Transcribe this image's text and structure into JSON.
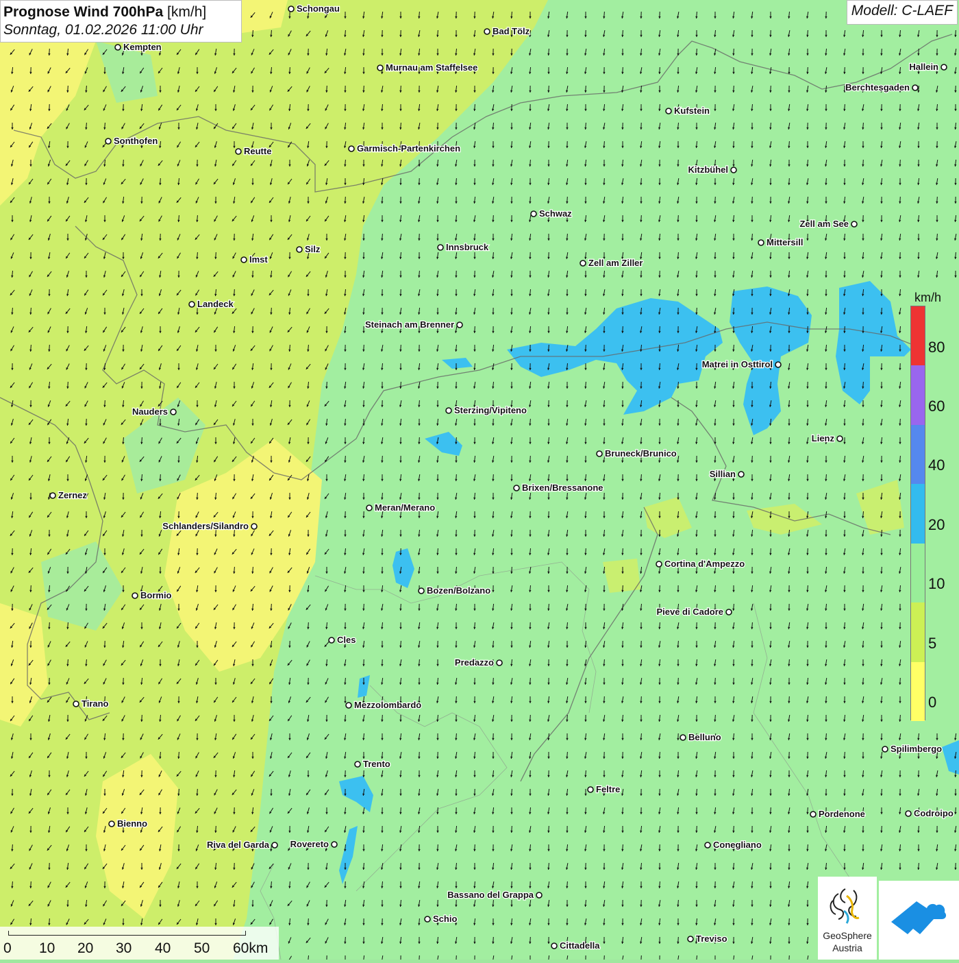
{
  "header": {
    "title_bold": "Prognose Wind 700hPa",
    "title_unit": "[km/h]",
    "datetime": "Sonntag, 01.02.2026 11:00 Uhr",
    "model": "Modell: C-LAEF"
  },
  "legend": {
    "unit": "km/h",
    "bins": [
      {
        "from": 0,
        "to": 5,
        "color": "#ffff66"
      },
      {
        "from": 5,
        "to": 10,
        "color": "#ccf055"
      },
      {
        "from": 10,
        "to": 20,
        "color": "#99ee99"
      },
      {
        "from": 20,
        "to": 40,
        "color": "#33bbee"
      },
      {
        "from": 40,
        "to": 60,
        "color": "#5588ee"
      },
      {
        "from": 60,
        "to": 80,
        "color": "#9966ee"
      },
      {
        "from": 80,
        "to": null,
        "color": "#ee3333"
      }
    ],
    "tick_labels": [
      "0",
      "5",
      "10",
      "20",
      "40",
      "60",
      "80"
    ]
  },
  "scale_bar": {
    "labels": [
      "0",
      "10",
      "20",
      "30",
      "40",
      "50",
      "60km"
    ]
  },
  "logos": {
    "geosphere_line1": "GeoSphere",
    "geosphere_line2": "Austria"
  },
  "places": [
    {
      "name": "Schongau"
    },
    {
      "name": "Bad Tölz"
    },
    {
      "name": "Kempten"
    },
    {
      "name": "Murnau am Staffelsee"
    },
    {
      "name": "Hallein"
    },
    {
      "name": "Berchtesgaden"
    },
    {
      "name": "Kufstein"
    },
    {
      "name": "Sonthofen"
    },
    {
      "name": "Reutte"
    },
    {
      "name": "Garmisch-Partenkirchen"
    },
    {
      "name": "Kitzbühel"
    },
    {
      "name": "Schwaz"
    },
    {
      "name": "Zell am See"
    },
    {
      "name": "Innsbruck"
    },
    {
      "name": "Mittersill"
    },
    {
      "name": "Silz"
    },
    {
      "name": "Imst"
    },
    {
      "name": "Zell am Ziller"
    },
    {
      "name": "Landeck"
    },
    {
      "name": "Steinach am Brenner"
    },
    {
      "name": "Matrei in Osttirol"
    },
    {
      "name": "Nauders"
    },
    {
      "name": "Sterzing/Vipiteno"
    },
    {
      "name": "Lienz"
    },
    {
      "name": "Bruneck/Brunico"
    },
    {
      "name": "Sillian"
    },
    {
      "name": "Brixen/Bressanone"
    },
    {
      "name": "Zernez"
    },
    {
      "name": "Meran/Merano"
    },
    {
      "name": "Schlanders/Silandro"
    },
    {
      "name": "Cortina d'Ampezzo"
    },
    {
      "name": "Bozen/Bolzano"
    },
    {
      "name": "Bormio"
    },
    {
      "name": "Pieve di Cadore"
    },
    {
      "name": "Cles"
    },
    {
      "name": "Predazzo"
    },
    {
      "name": "Tirano"
    },
    {
      "name": "Mezzolombardo"
    },
    {
      "name": "Belluno"
    },
    {
      "name": "Spilimbergo"
    },
    {
      "name": "Trento"
    },
    {
      "name": "Feltre"
    },
    {
      "name": "Pordenone"
    },
    {
      "name": "Codroipo"
    },
    {
      "name": "Bienno"
    },
    {
      "name": "Riva del Garda"
    },
    {
      "name": "Rovereto"
    },
    {
      "name": "Conegliano"
    },
    {
      "name": "Bassano del Grappa"
    },
    {
      "name": "Schio"
    },
    {
      "name": "Treviso"
    },
    {
      "name": "Cittadella"
    }
  ]
}
